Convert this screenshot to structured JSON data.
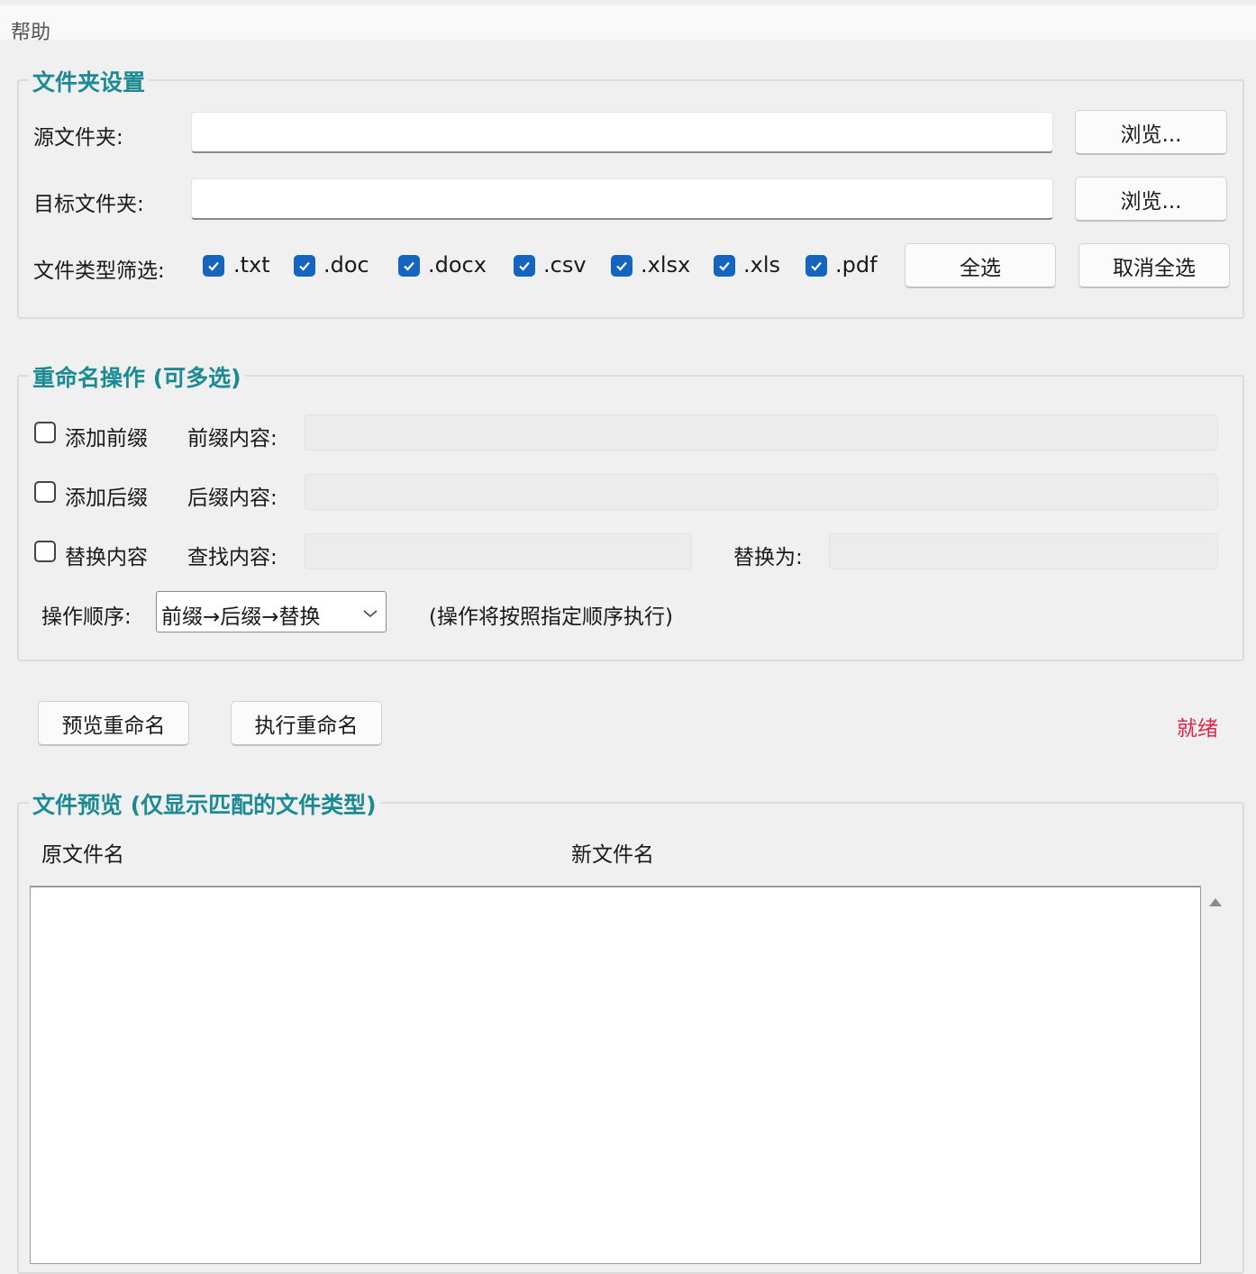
{
  "menu": {
    "help": "帮助"
  },
  "folder_settings": {
    "title": "文件夹设置",
    "source_label": "源文件夹:",
    "source_value": "",
    "target_label": "目标文件夹:",
    "target_value": "",
    "browse_label": "浏览...",
    "filter_label": "文件类型筛选:",
    "extensions": [
      {
        "label": ".txt",
        "checked": true
      },
      {
        "label": ".doc",
        "checked": true
      },
      {
        "label": ".docx",
        "checked": true
      },
      {
        "label": ".csv",
        "checked": true
      },
      {
        "label": ".xlsx",
        "checked": true
      },
      {
        "label": ".xls",
        "checked": true
      },
      {
        "label": ".pdf",
        "checked": true
      }
    ],
    "select_all": "全选",
    "deselect_all": "取消全选"
  },
  "rename_ops": {
    "title": "重命名操作 (可多选)",
    "add_prefix": {
      "label": "添加前缀",
      "checked": false,
      "field_label": "前缀内容:",
      "value": ""
    },
    "add_suffix": {
      "label": "添加后缀",
      "checked": false,
      "field_label": "后缀内容:",
      "value": ""
    },
    "replace": {
      "label": "替换内容",
      "checked": false,
      "find_label": "查找内容:",
      "find_value": "",
      "replace_label": "替换为:",
      "replace_value": ""
    },
    "order_label": "操作顺序:",
    "order_value": "前缀→后缀→替换",
    "order_hint": "(操作将按照指定顺序执行)"
  },
  "actions": {
    "preview": "预览重命名",
    "execute": "执行重命名",
    "status": "就绪"
  },
  "preview": {
    "title": "文件预览 (仅显示匹配的文件类型)",
    "col_original": "原文件名",
    "col_new": "新文件名",
    "rows": []
  },
  "colors": {
    "group_title": "#1c8a93",
    "status": "#e0244a",
    "checkbox": "#1565c0"
  }
}
